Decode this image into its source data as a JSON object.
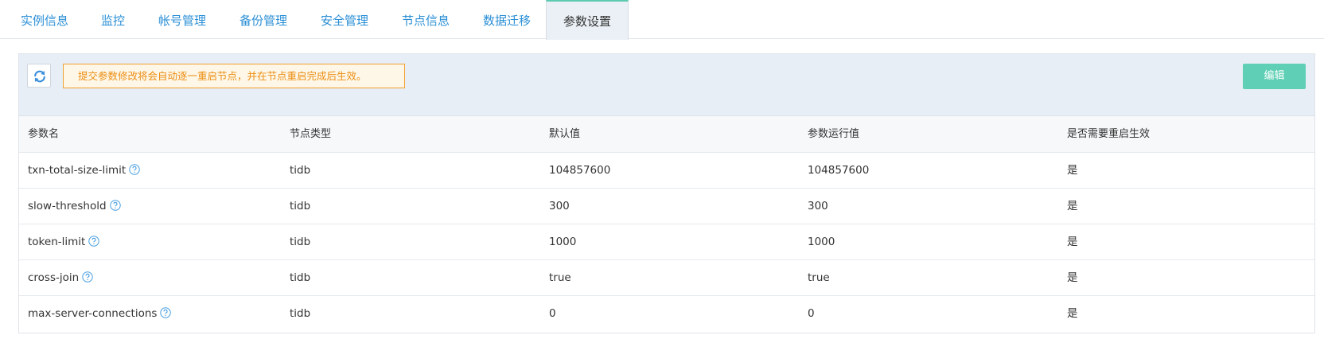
{
  "tabs": [
    {
      "label": "实例信息"
    },
    {
      "label": "监控"
    },
    {
      "label": "帐号管理"
    },
    {
      "label": "备份管理"
    },
    {
      "label": "安全管理"
    },
    {
      "label": "节点信息"
    },
    {
      "label": "数据迁移"
    },
    {
      "label": "参数设置",
      "active": true
    }
  ],
  "toolbar": {
    "refresh_icon": "refresh-icon",
    "notice": "提交参数修改将会自动逐一重启节点，并在节点重启完成后生效。",
    "edit_label": "编辑"
  },
  "table": {
    "headers": [
      "参数名",
      "节点类型",
      "默认值",
      "参数运行值",
      "是否需要重启生效"
    ],
    "rows": [
      {
        "name": "txn-total-size-limit",
        "node_type": "tidb",
        "default": "104857600",
        "running": "104857600",
        "restart": "是"
      },
      {
        "name": "slow-threshold",
        "node_type": "tidb",
        "default": "300",
        "running": "300",
        "restart": "是"
      },
      {
        "name": "token-limit",
        "node_type": "tidb",
        "default": "1000",
        "running": "1000",
        "restart": "是"
      },
      {
        "name": "cross-join",
        "node_type": "tidb",
        "default": "true",
        "running": "true",
        "restart": "是"
      },
      {
        "name": "max-server-connections",
        "node_type": "tidb",
        "default": "0",
        "running": "0",
        "restart": "是"
      }
    ]
  },
  "colors": {
    "tab_link": "#2b8fd6",
    "active_tab_accent": "#5ccbb0",
    "edit_button": "#5fd0b5",
    "notice_border": "#f0a030",
    "notice_text": "#ec8d12",
    "toolbar_bg": "#e7eef5",
    "help_icon": "#4a9fe0"
  }
}
